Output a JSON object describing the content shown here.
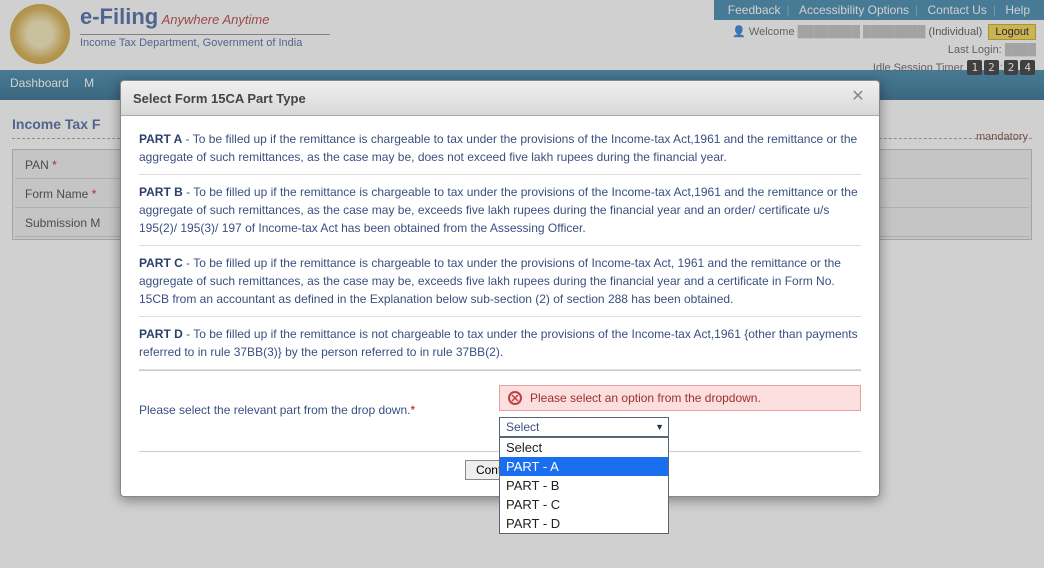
{
  "brand": {
    "title": "e-Filing",
    "tagline": "Anywhere Anytime",
    "dept": "Income Tax Department, Government of India",
    "emblem_alt": "emblem"
  },
  "top_links": {
    "feedback": "Feedback",
    "accessibility": "Accessibility Options",
    "contact": "Contact Us",
    "help": "Help"
  },
  "user": {
    "welcome": "Welcome",
    "role": "(Individual)",
    "logout": "Logout",
    "last_login_label": "Last Login:",
    "idle_label": "Idle Session Timer",
    "timer": [
      "1",
      "2",
      ":",
      "2",
      "4"
    ]
  },
  "nav": {
    "dashboard": "Dashboard",
    "my": "M"
  },
  "page": {
    "title": "Income Tax F",
    "mandatory_note": "mandatory",
    "fields": {
      "pan": "PAN",
      "form_name": "Form Name",
      "submission_mode": "Submission M"
    }
  },
  "modal": {
    "title": "Select Form 15CA Part Type",
    "parts": [
      {
        "label": "PART A",
        "text": " - To be filled up if the remittance is chargeable to tax under the provisions of the Income-tax Act,1961 and the remittance or the aggregate of such remittances, as the case may be, does not exceed five lakh rupees during the financial year."
      },
      {
        "label": "PART B",
        "text": " - To be filled up if the remittance is chargeable to tax under the provisions of the Income-tax Act,1961 and the remittance or the aggregate of such remittances, as the case may be, exceeds five lakh rupees during the financial year and an order/ certificate u/s 195(2)/ 195(3)/ 197 of Income-tax Act has been obtained from the Assessing Officer."
      },
      {
        "label": "PART C",
        "text": " - To be filled up if the remittance is chargeable to tax under the provisions of Income-tax Act, 1961 and the remittance or the aggregate of such remittances, as the case may be, exceeds five lakh rupees during the financial year and a certificate in Form No. 15CB from an accountant as defined in the Explanation below sub-section (2) of section 288 has been obtained."
      },
      {
        "label": "PART D",
        "text": " - To be filled up if the remittance is not chargeable to tax under the provisions of the Income-tax Act,1961 {other than payments referred to in rule 37BB(3)} by the person referred to in rule 37BB(2)."
      }
    ],
    "select_prompt": "Please select the relevant part from the drop down.",
    "error_msg": "Please select an option from the dropdown.",
    "selected": "Select",
    "options": [
      "Select",
      "PART - A",
      "PART - B",
      "PART - C",
      "PART - D"
    ],
    "highlighted_index": 1,
    "continue": "Continue"
  }
}
